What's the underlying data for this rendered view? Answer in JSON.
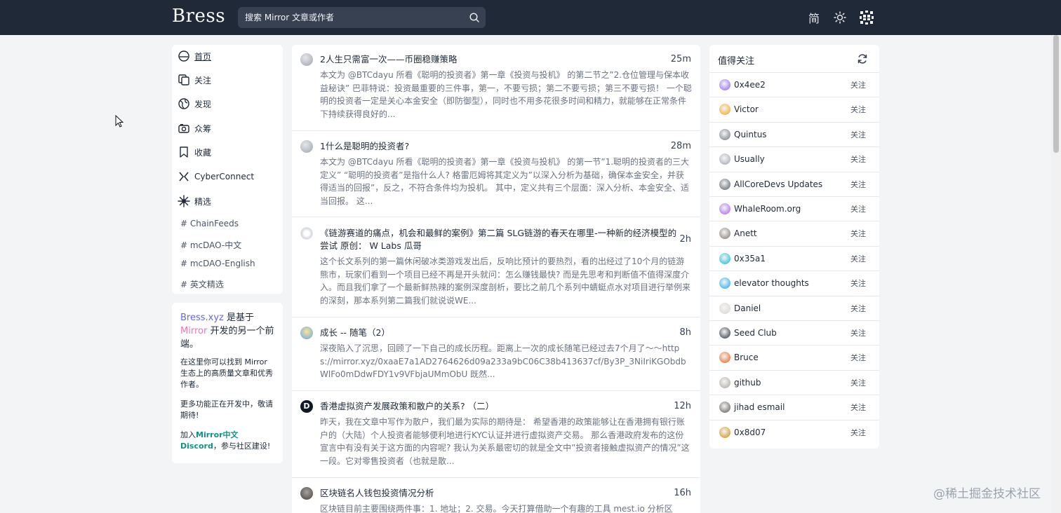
{
  "header": {
    "logo": "Bress",
    "search_placeholder": "搜索 Mirror 文章或作者",
    "lang_label": "简"
  },
  "nav": {
    "items": [
      {
        "label": "首页"
      },
      {
        "label": "关注"
      },
      {
        "label": "发现"
      },
      {
        "label": "众筹"
      },
      {
        "label": "收藏"
      },
      {
        "label": "CyberConnect"
      },
      {
        "label": "精选"
      }
    ],
    "tags": [
      "# ChainFeeds",
      "# mcDAO-中文",
      "# mcDAO-English",
      "# 英文精选"
    ]
  },
  "info": {
    "brand": "Bress.xyz",
    "is_based_on": " 是基于",
    "mirror": "Mirror",
    "rest": " 开发的另一个前端。",
    "p1": "在这里你可以找到 Mirror 生态上的高质量文章和优秀作者。",
    "p2": "更多功能正在开发中，敬请期待!",
    "p3_prefix": "加入",
    "p3_link": "Mirror中文 Discord",
    "p3_suffix": "，参与社区建设!"
  },
  "posts": [
    {
      "title": "2人生只需富一次——币圈稳赚策略",
      "time": "25m",
      "body": "本文为 @BTCdayu 所看《聪明的投资者》第一章《投资与投机》 的第二节之”2.仓位管理与保本收益秘诀” 巴菲特说：投资最重要的三件事，第一，不要亏损；第二不要亏损；第三不要亏损！ 一个聪明的投资者一定是关心本金安全（即防御型），同时也不用多花很多时间和精力，就能够在正常条件下持续获得良好的..."
    },
    {
      "title": "1什么是聪明的投资者?",
      "time": "28m",
      "body": "本文为 @BTCdayu 所看《聪明的投资者》第一章《投资与投机》 的第一节”1.聪明的投资者的三大定义” “聪明的投资者”是指什么人? 格雷厄姆将其定义为”以深入分析为基础，确保本金安全，并获得适当的回报”，反之，不符合条件均为投机。 其中，定义共有三个层面：深入分析、本金安全、适当回报。 这..."
    },
    {
      "title": "《链游赛道的痛点，机会和最鲜的案例》第二篇 SLG链游的春天在哪里-一种新的经济模型的尝试 原创： W Labs 瓜哥",
      "time": "2h",
      "body": "这个长文系列的第一篇休闲破冰类游戏发出后，反响比预计的要热烈，看的出经过了10个月的链游熊市，玩家们看到一个项目已经不再是开头就问：怎么赚钱最快? 而是先思考和判断值不值得深度介入。而且我们拿了一个最新鲜热辣的案例深度剖析，要比之前几个系列中蜻蜓点水对项目进行举例来的深刻，那本系列第二篇我们就说说WE..."
    },
    {
      "title": "成长 -- 随笔（2）",
      "time": "8h",
      "body": "深夜陷入了沉思，回顾了一下自己的成长历程。距离上一次的成长随笔已经过去7个月了～～https://mirror.xyz/0xaaE7a1AD2764626d09a233a9bC06C38b413637cf/By3P_3NiIriKGObdbWlFo0mDdwFDY1v9VFbjaUMmObU 既然..."
    },
    {
      "title": "香港虚拟资产发展政策和散户的关系? （二）",
      "time": "12h",
      "body": "昨天，我在文章中写作为散户，我们最为实际的期待是： 希望香港的政策能够让在香港拥有银行账户的（大陆）个人投资者能够便利地进行KYC认证并进行虚拟资产交易。 那么香港政府发布的这份宣言中有没有关于这方面的内容呢? 我认为关系最密切的就是全文中”投资者接触虚拟资产的情况”这一段。它对零售投资者（也就是散..."
    },
    {
      "title": "区块链名人钱包投资情况分析",
      "time": "16h",
      "body": "区块链目前主要围绕两件事：1. 地址；2. 交易。今天打算借助一个有趣的工具 mest.io 分析区"
    }
  ],
  "follow": {
    "title": "值得关注",
    "button_label": "关注",
    "users": [
      {
        "name": "0x4ee2",
        "color": "#8b5cf6"
      },
      {
        "name": "Victor",
        "color": "#f59e0b"
      },
      {
        "name": "Quintus",
        "color": "#6b7280"
      },
      {
        "name": "Usually",
        "color": "#9ca3af"
      },
      {
        "name": "AllCoreDevs Updates",
        "color": "#4b5563"
      },
      {
        "name": "WhaleRoom.org",
        "color": "#a855f7"
      },
      {
        "name": "Anett",
        "color": "#78716c"
      },
      {
        "name": "0x35a1",
        "color": "#06b6d4"
      },
      {
        "name": "elevator thoughts",
        "color": "#0ea5e9"
      },
      {
        "name": "Daniel",
        "color": "#d6d3d1"
      },
      {
        "name": "Seed Club",
        "color": "#1f2937"
      },
      {
        "name": "Bruce",
        "color": "#ea580c"
      },
      {
        "name": "github",
        "color": "#a8a29e"
      },
      {
        "name": "jihad esmail",
        "color": "#57534e"
      },
      {
        "name": "0x8d07",
        "color": "#ca8a04"
      }
    ]
  },
  "watermark": "@稀土掘金技术社区"
}
